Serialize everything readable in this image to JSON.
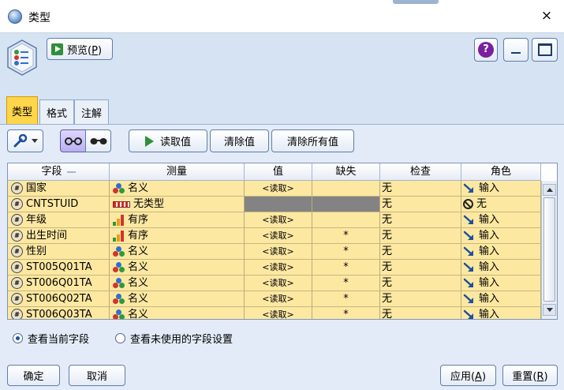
{
  "window": {
    "title": "类型",
    "close": "×"
  },
  "toolbar": {
    "preview_label": "预览",
    "preview_key": "P",
    "help_label": "?"
  },
  "tabs": [
    {
      "label": "类型",
      "active": true
    },
    {
      "label": "格式",
      "active": false
    },
    {
      "label": "注解",
      "active": false
    }
  ],
  "actions": {
    "read_values": "读取值",
    "clear_values": "清除值",
    "clear_all_values": "清除所有值"
  },
  "table": {
    "columns": [
      "字段",
      "测量",
      "值",
      "缺失",
      "检查",
      "角色"
    ],
    "rows": [
      {
        "field": "国家",
        "measure": "名义",
        "measure_type": "nominal",
        "value": "<读取>",
        "missing": "",
        "check": "无",
        "role": "输入",
        "role_type": "input"
      },
      {
        "field": "CNTSTUID",
        "measure": "无类型",
        "measure_type": "typeless",
        "value": "",
        "missing": "",
        "check": "无",
        "role": "无",
        "role_type": "none",
        "grey": true
      },
      {
        "field": "年级",
        "measure": "有序",
        "measure_type": "ordinal",
        "value": "<读取>",
        "missing": "",
        "check": "无",
        "role": "输入",
        "role_type": "input"
      },
      {
        "field": "出生时间",
        "measure": "有序",
        "measure_type": "ordinal",
        "value": "<读取>",
        "missing": "*",
        "check": "无",
        "role": "输入",
        "role_type": "input"
      },
      {
        "field": "性别",
        "measure": "名义",
        "measure_type": "nominal",
        "value": "<读取>",
        "missing": "*",
        "check": "无",
        "role": "输入",
        "role_type": "input"
      },
      {
        "field": "ST005Q01TA",
        "measure": "名义",
        "measure_type": "nominal",
        "value": "<读取>",
        "missing": "*",
        "check": "无",
        "role": "输入",
        "role_type": "input"
      },
      {
        "field": "ST006Q01TA",
        "measure": "名义",
        "measure_type": "nominal",
        "value": "<读取>",
        "missing": "*",
        "check": "无",
        "role": "输入",
        "role_type": "input"
      },
      {
        "field": "ST006Q02TA",
        "measure": "名义",
        "measure_type": "nominal",
        "value": "<读取>",
        "missing": "*",
        "check": "无",
        "role": "输入",
        "role_type": "input"
      },
      {
        "field": "ST006Q03TA",
        "measure": "名义",
        "measure_type": "nominal",
        "value": "<读取>",
        "missing": "*",
        "check": "无",
        "role": "输入",
        "role_type": "input"
      }
    ]
  },
  "view_options": {
    "current": "查看当前字段",
    "unused": "查看未使用的字段设置",
    "selected": "current"
  },
  "footer": {
    "ok": "确定",
    "cancel": "取消",
    "apply": "应用",
    "apply_key": "A",
    "reset": "重置",
    "reset_key": "R"
  },
  "colors": {
    "row_bg": "#fde8a2",
    "active_tab": "#ffd54a",
    "panel_bg": "#e2ebf7"
  }
}
